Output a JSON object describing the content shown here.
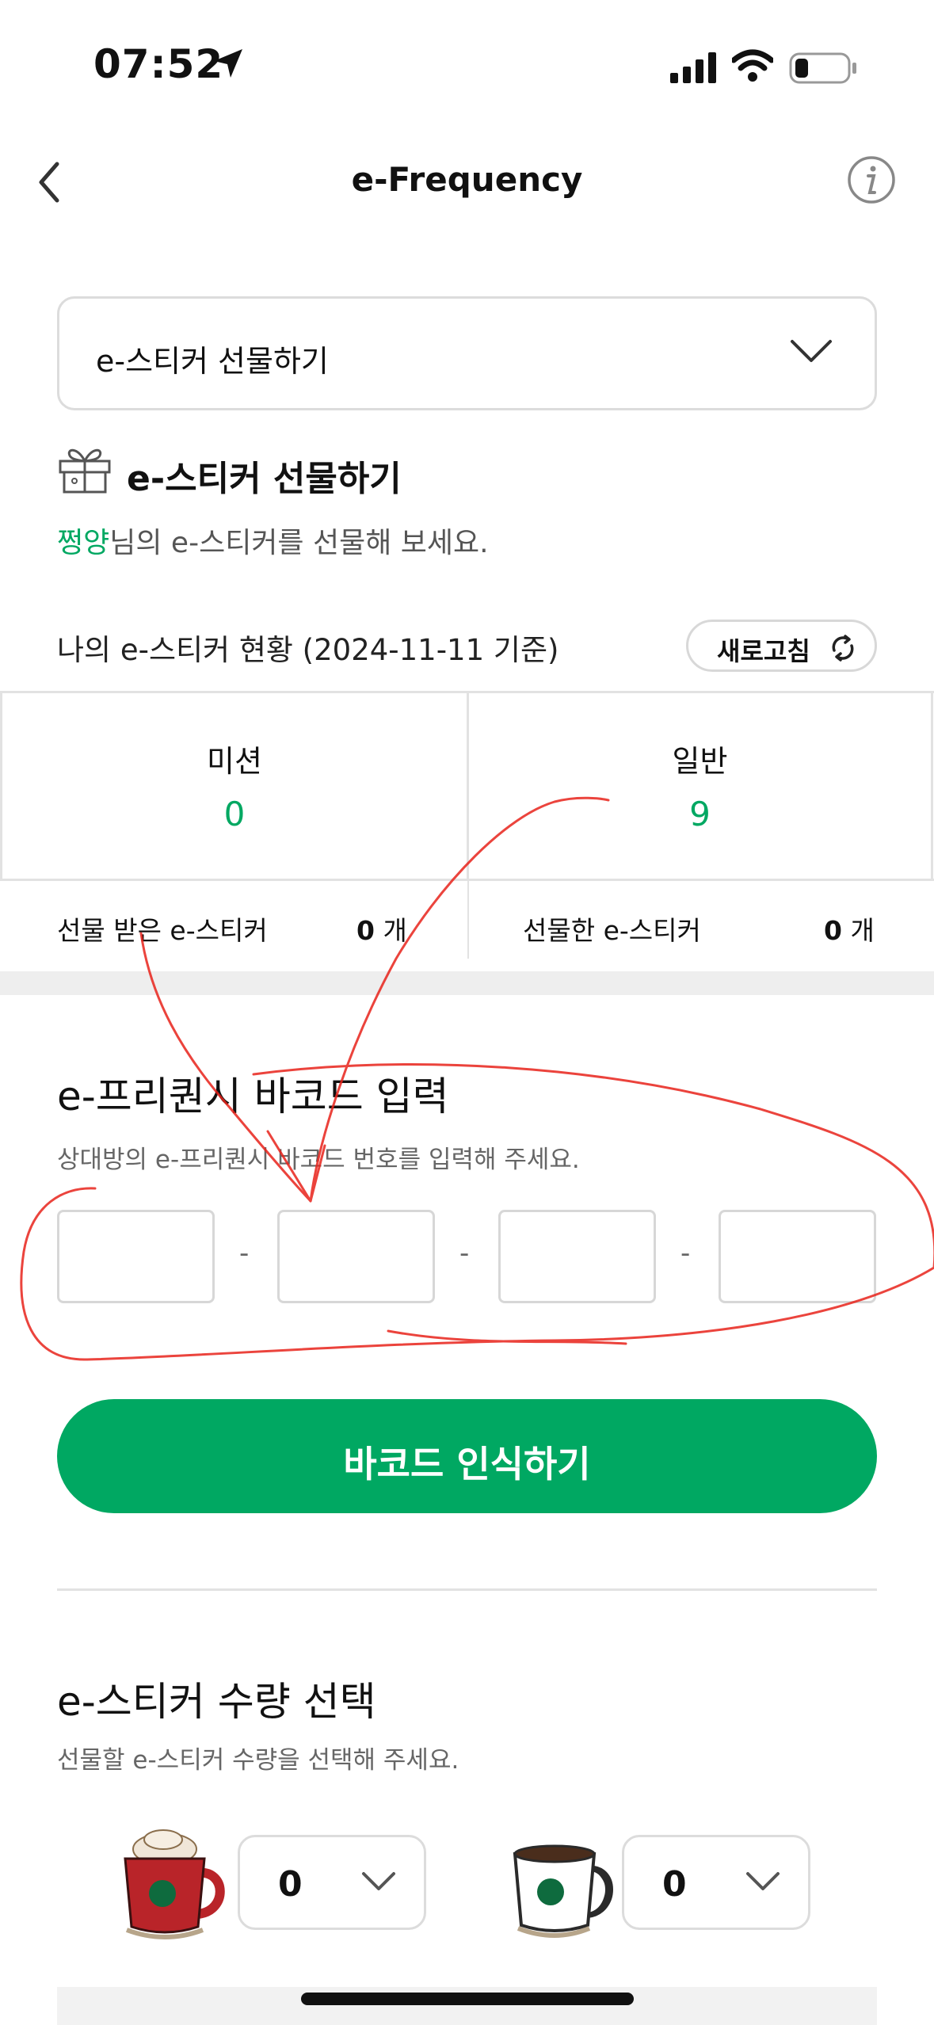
{
  "status_bar": {
    "time": "07:52"
  },
  "nav": {
    "title": "e-Frequency"
  },
  "dropdown": {
    "selected": "e-스티커 선물하기"
  },
  "gift_section": {
    "title": "e-스티커 선물하기",
    "user_name": "쩡양",
    "desc_suffix": "님의 e-스티커를 선물해 보세요."
  },
  "sticker_status": {
    "label": "나의 e-스티커 현황 (2024-11-11 기준)",
    "refresh_label": "새로고침"
  },
  "counts": [
    {
      "label": "미션",
      "value": "0"
    },
    {
      "label": "일반",
      "value": "9"
    }
  ],
  "gift_counts": [
    {
      "label": "선물 받은 e-스티커",
      "value": "0",
      "unit": "개"
    },
    {
      "label": "선물한 e-스티커",
      "value": "0",
      "unit": "개"
    }
  ],
  "barcode": {
    "title": "e-프리퀀시 바코드 입력",
    "desc": "상대방의 e-프리퀀시 바코드 번호를 입력해 주세요.",
    "fields": [
      "",
      "",
      "",
      ""
    ],
    "separator": "-",
    "scan_label": "바코드 인식하기"
  },
  "quantity": {
    "title": "e-스티커 수량 선택",
    "desc": "선물할 e-스티커 수량을 선택해 주세요.",
    "items": [
      {
        "icon": "red-mug-icon",
        "value": "0"
      },
      {
        "icon": "white-mug-icon",
        "value": "0"
      }
    ]
  },
  "colors": {
    "accent": "#00a862",
    "annotation": "#e8231b"
  }
}
